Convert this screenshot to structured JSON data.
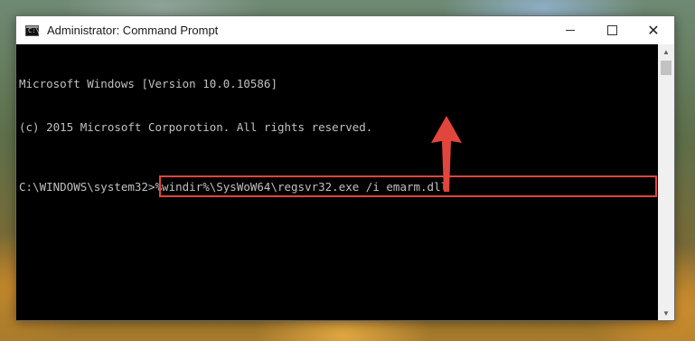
{
  "window": {
    "title": "Administrator: Command Prompt",
    "app_icon_text": "C:\\_",
    "controls": {
      "minimize": "minimize",
      "maximize": "maximize",
      "close": "✕"
    }
  },
  "console": {
    "lines": [
      "Microsoft Windows [Version 10.0.10586]",
      "(c) 2015 Microsoft Corporotion. All rights reserved."
    ],
    "prompt": "C:\\WINDOWS\\system32>",
    "command": "%windir%\\SysWoW64\\regsvr32.exe /i emarm.dll"
  },
  "annotation": {
    "highlight_color": "#e0463c",
    "arrow_color": "#e0463c",
    "arrow_icon": "up-arrow-icon"
  },
  "scrollbar": {
    "up_glyph": "▲",
    "down_glyph": "▼"
  }
}
